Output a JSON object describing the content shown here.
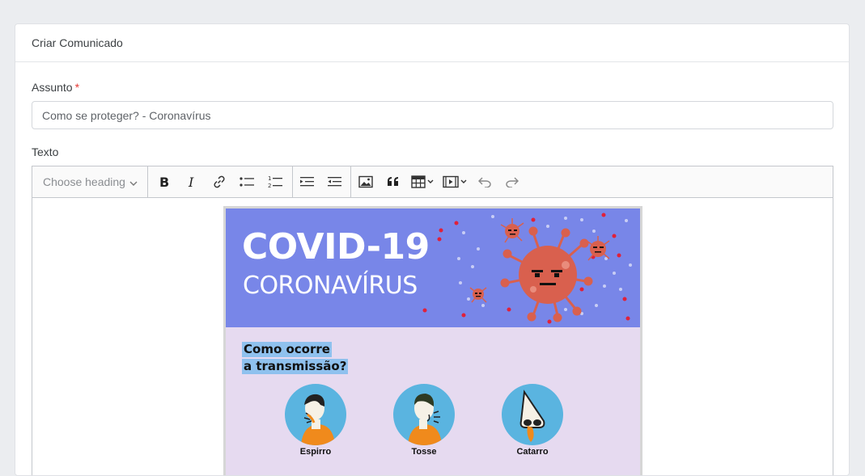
{
  "card": {
    "title": "Criar Comunicado"
  },
  "form": {
    "subject_label": "Assunto",
    "subject_required": "*",
    "subject_value": "Como se proteger? - Coronavírus",
    "text_label": "Texto"
  },
  "toolbar": {
    "heading_placeholder": "Choose heading",
    "buttons": [
      "bold",
      "italic",
      "link",
      "bulleted-list",
      "numbered-list",
      "outdent",
      "indent",
      "image",
      "block-quote",
      "table",
      "media",
      "undo",
      "redo"
    ]
  },
  "poster": {
    "title": "COVID-19",
    "subtitle": "CORONAVÍRUS",
    "question_line1": "Como ocorre",
    "question_line2": "a transmissão?",
    "symptoms": [
      {
        "label": "Espirro"
      },
      {
        "label": "Tosse"
      },
      {
        "label": "Catarro"
      }
    ],
    "colors": {
      "banner": "#7886e8",
      "body": "#e6daf0",
      "virus": "#d9604e",
      "highlight": "#8fc1ee"
    }
  }
}
